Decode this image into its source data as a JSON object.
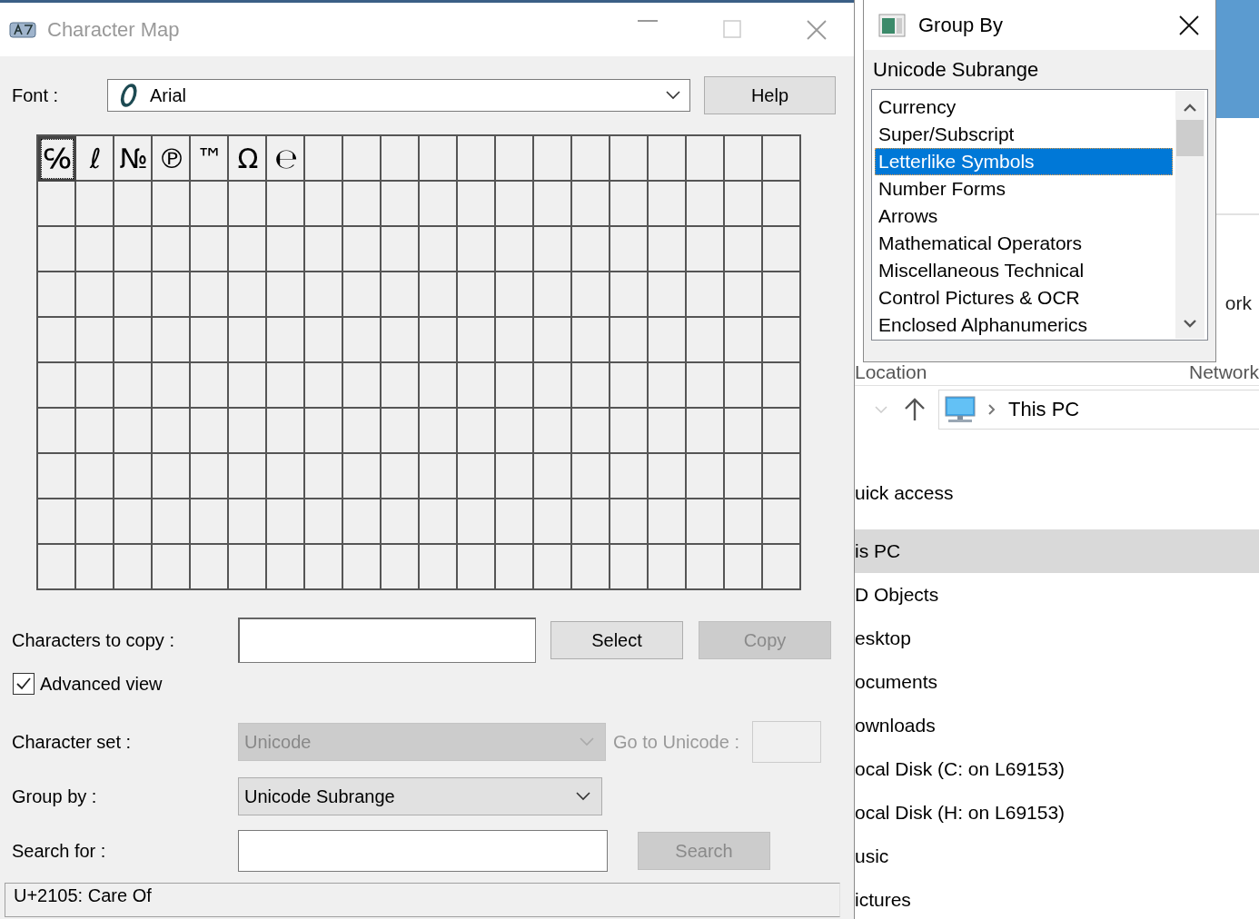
{
  "charmap": {
    "title": "Character Map",
    "font_label": "Font :",
    "font_value": "Arial",
    "help_button": {
      "label": "Help",
      "disabled": false
    },
    "characters": [
      {
        "char": "℅",
        "selected": true
      },
      {
        "char": "ℓ",
        "selected": false
      },
      {
        "char": "№",
        "selected": false
      },
      {
        "char": "℗",
        "selected": false
      },
      {
        "char": "™",
        "selected": false
      },
      {
        "char": "Ω",
        "selected": false
      },
      {
        "char": "℮",
        "selected": false
      }
    ],
    "copy_label": "Characters to copy :",
    "select_button": {
      "label": "Select",
      "disabled": false
    },
    "copy_button": {
      "label": "Copy",
      "disabled": true
    },
    "advanced_view": {
      "label": "Advanced view",
      "checked": true
    },
    "character_set": {
      "label": "Character set :",
      "value": "Unicode",
      "disabled": true
    },
    "goto_unicode": {
      "label": "Go to Unicode :",
      "disabled": true
    },
    "group_by": {
      "label": "Group by :",
      "value": "Unicode Subrange"
    },
    "search_for": {
      "label": "Search for :"
    },
    "search_button": {
      "label": "Search",
      "disabled": true
    },
    "status": "U+2105: Care Of"
  },
  "group_by_popup": {
    "title": "Group By",
    "heading": "Unicode Subrange",
    "items": [
      {
        "label": "Currency",
        "selected": false
      },
      {
        "label": "Super/Subscript",
        "selected": false
      },
      {
        "label": "Letterlike Symbols",
        "selected": true
      },
      {
        "label": "Number Forms",
        "selected": false
      },
      {
        "label": "Arrows",
        "selected": false
      },
      {
        "label": "Mathematical Operators",
        "selected": false
      },
      {
        "label": "Miscellaneous Technical",
        "selected": false
      },
      {
        "label": "Control Pictures & OCR",
        "selected": false
      },
      {
        "label": "Enclosed Alphanumerics",
        "selected": false
      }
    ]
  },
  "explorer": {
    "partial_text": "ork",
    "ribbon_groups": [
      "Location",
      "Network"
    ],
    "address": "This PC",
    "sidebar": [
      {
        "label": "uick access",
        "selected": false
      },
      {
        "label": "is PC",
        "selected": true
      },
      {
        "label": "D Objects",
        "selected": false
      },
      {
        "label": "esktop",
        "selected": false
      },
      {
        "label": "ocuments",
        "selected": false
      },
      {
        "label": "ownloads",
        "selected": false
      },
      {
        "label": "ocal Disk (C: on L69153)",
        "selected": false
      },
      {
        "label": "ocal Disk (H: on L69153)",
        "selected": false
      },
      {
        "label": "usic",
        "selected": false
      },
      {
        "label": "ictures",
        "selected": false
      }
    ]
  }
}
